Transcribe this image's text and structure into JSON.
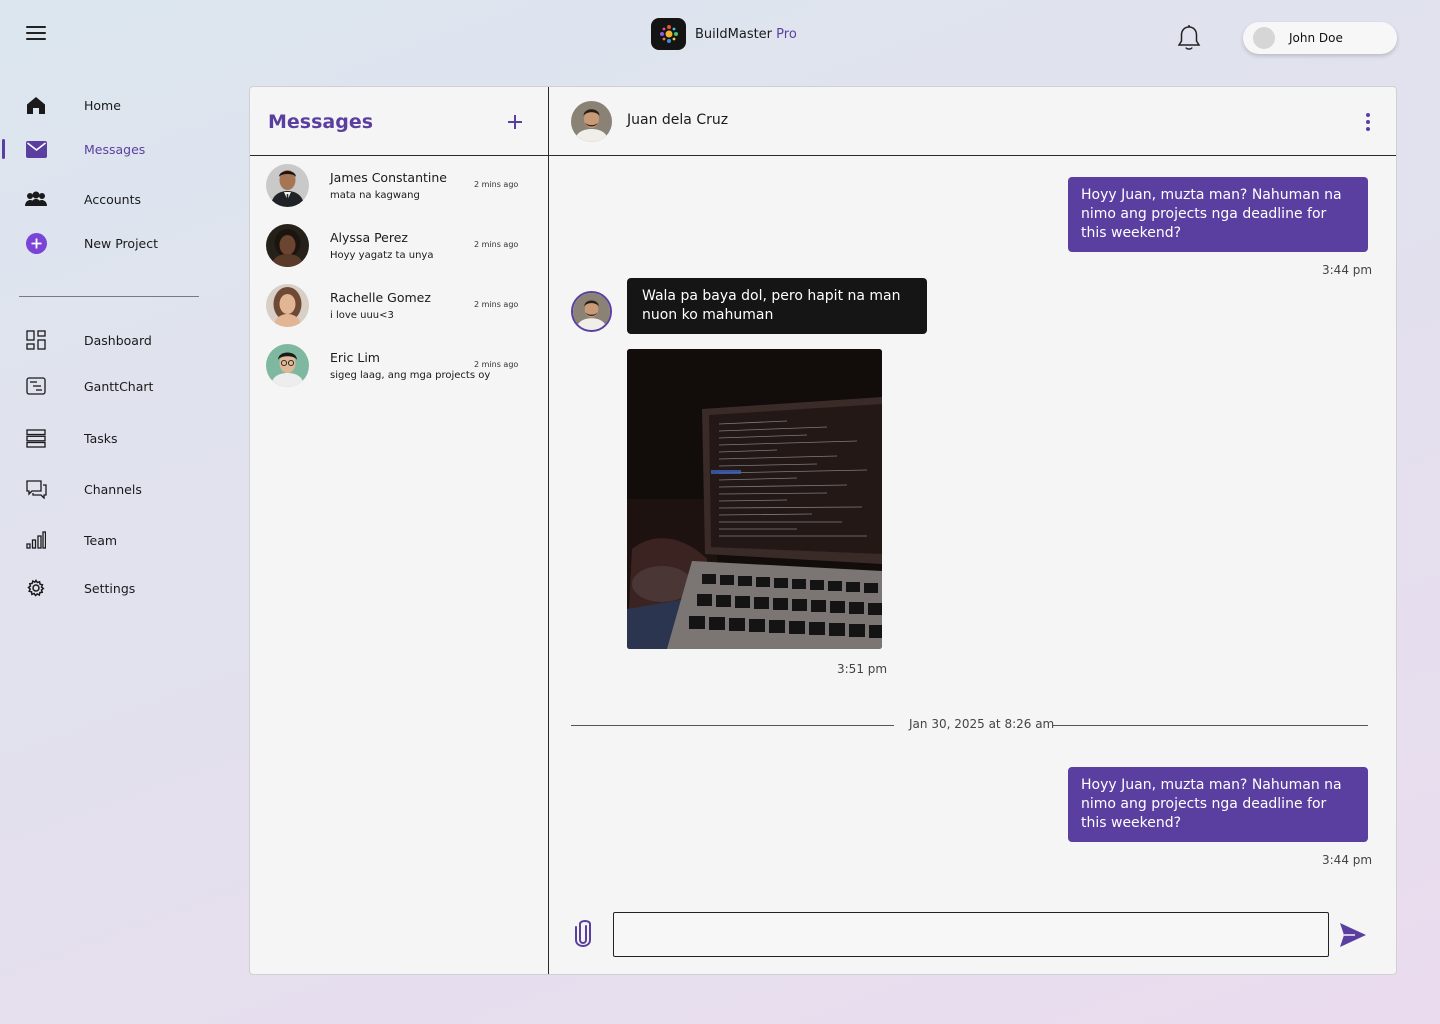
{
  "app": {
    "name": "BuildMaster",
    "tier": "Pro"
  },
  "user": {
    "name": "John Doe"
  },
  "sidebar": {
    "items": [
      {
        "label": "Home",
        "icon": "home-icon"
      },
      {
        "label": "Messages",
        "icon": "mail-icon",
        "active": true
      },
      {
        "label": "Accounts",
        "icon": "accounts-icon"
      },
      {
        "label": "New Project",
        "icon": "plus-circle-icon"
      },
      {
        "label": "Dashboard",
        "icon": "dashboard-icon"
      },
      {
        "label": "GanttChart",
        "icon": "gantt-icon"
      },
      {
        "label": "Tasks",
        "icon": "tasks-icon"
      },
      {
        "label": "Channels",
        "icon": "channels-icon"
      },
      {
        "label": "Team",
        "icon": "team-icon"
      },
      {
        "label": "Settings",
        "icon": "gear-icon"
      }
    ]
  },
  "conversations": {
    "title": "Messages",
    "items": [
      {
        "name": "James Constantine",
        "preview": "mata na kagwang",
        "time": "2 mins ago"
      },
      {
        "name": "Alyssa Perez",
        "preview": "Hoyy yagatz ta unya",
        "time": "2 mins ago"
      },
      {
        "name": "Rachelle Gomez",
        "preview": "i love uuu<3",
        "time": "2 mins ago"
      },
      {
        "name": "Eric Lim",
        "preview": "sigeg laag, ang mga projects oy",
        "time": "2 mins ago"
      }
    ]
  },
  "chat": {
    "contact": "Juan dela Cruz",
    "messages": [
      {
        "direction": "out",
        "text": "Hoyy Juan, muzta man? Nahuman na nimo ang projects nga deadline for this weekend?",
        "time": "3:44 pm"
      },
      {
        "direction": "in",
        "text": "Wala pa baya dol, pero hapit na man nuon ko mahuman"
      },
      {
        "direction": "in",
        "type": "image",
        "time": "3:51 pm"
      },
      {
        "direction": "out",
        "text": "Hoyy Juan, muzta man? Nahuman na nimo ang projects nga deadline for this weekend?",
        "time": "3:44 pm"
      }
    ],
    "date_separator": "Jan 30, 2025 at 8:26 am",
    "input": {
      "value": "",
      "placeholder": ""
    }
  },
  "colors": {
    "accent": "#5b3fa0",
    "incoming_bubble": "#151515",
    "panel_bg": "#f5f5f5"
  }
}
